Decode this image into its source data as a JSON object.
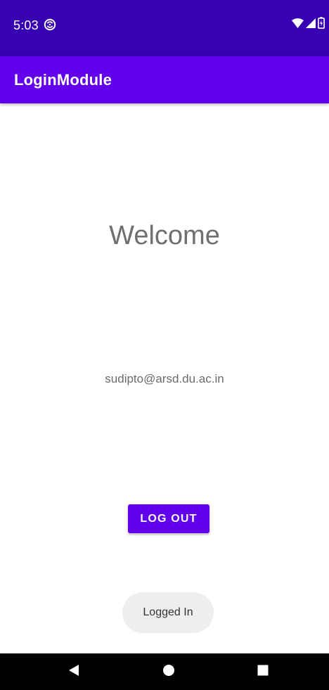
{
  "status_bar": {
    "time": "5:03",
    "icons": [
      "sync-icon",
      "wifi-icon",
      "signal-icon",
      "battery-icon"
    ]
  },
  "app_bar": {
    "title": "LoginModule",
    "color": "#6200ee"
  },
  "main": {
    "welcome_text": "Welcome",
    "email": "sudipto@arsd.du.ac.in",
    "logout_label": "LOG OUT"
  },
  "toast": {
    "message": "Logged In"
  },
  "nav_bar": {
    "icons": [
      "back-icon",
      "home-icon",
      "recents-icon"
    ]
  },
  "colors": {
    "status_bar": "#3700b3",
    "primary": "#6200ee",
    "nav_bar": "#000000"
  }
}
